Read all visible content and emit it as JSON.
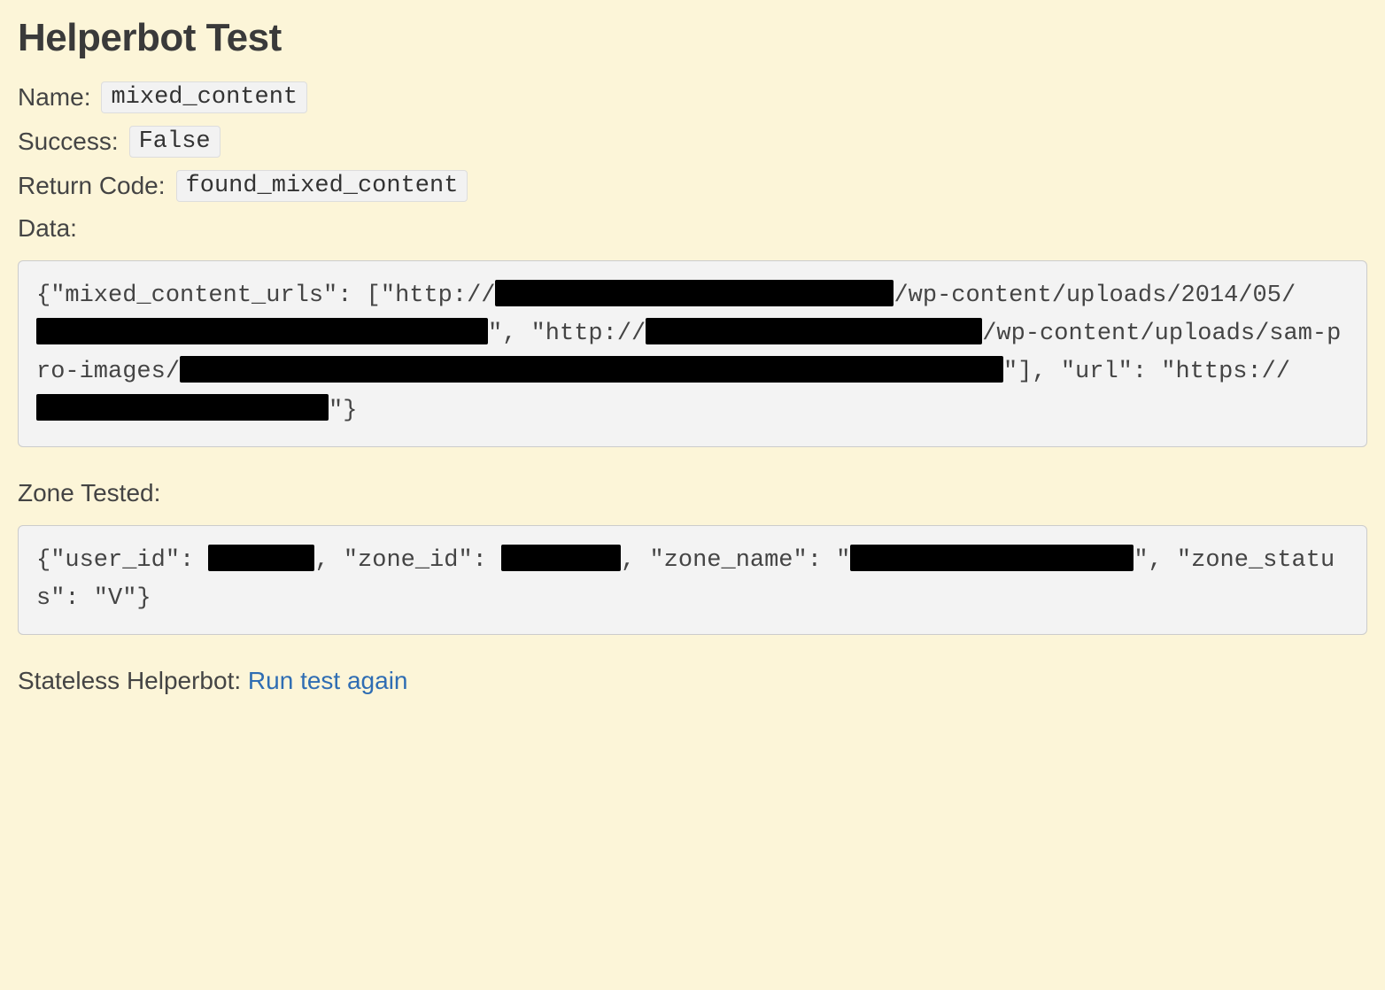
{
  "header": {
    "title": "Helperbot Test"
  },
  "fields": {
    "name_label": "Name:",
    "name_value": "mixed_content",
    "success_label": "Success:",
    "success_value": "False",
    "return_code_label": "Return Code:",
    "return_code_value": "found_mixed_content",
    "data_label": "Data:"
  },
  "data_block": {
    "segments": {
      "s0": "{\"mixed_content_urls\": [\"http://",
      "s1": "/wp-content/uploads/2014/05/",
      "s2": "\", \"http://",
      "s3": "/wp-content/uploads/sam-pro-images/",
      "s4": "\"], \"url\": \"https://",
      "s5": "\"}"
    }
  },
  "zone": {
    "label": "Zone Tested:",
    "segments": {
      "s0": "{\"user_id\": ",
      "s1": ", \"zone_id\": ",
      "s2": ", \"zone_name\": \"",
      "s3": "\", \"zone_status\": \"V\"}"
    }
  },
  "footer": {
    "prefix": "Stateless Helperbot: ",
    "link_label": "Run test again"
  }
}
